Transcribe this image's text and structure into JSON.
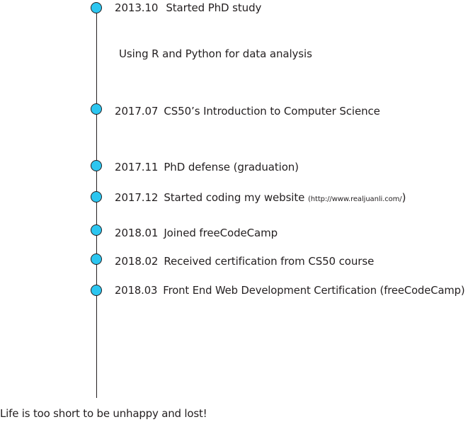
{
  "timeline": {
    "entries": [
      {
        "date": "2013.10",
        "text": "Started PhD study",
        "link": ""
      },
      {
        "date": "2017.07",
        "text": "CS50’s Introduction to Computer Science",
        "link": ""
      },
      {
        "date": "2017.11",
        "text": "PhD defense (graduation)",
        "link": ""
      },
      {
        "date": "2017.12",
        "text": "Started coding my website ",
        "link": "(http://www.realjuanli.com/",
        "link_close": ")"
      },
      {
        "date": "2018.01",
        "text": "Joined freeCodeCamp",
        "link": ""
      },
      {
        "date": "2018.02",
        "text": "Received certification from CS50 course",
        "link": ""
      },
      {
        "date": "2018.03",
        "text": "Front End Web Development Certification (freeCodeCamp)",
        "link": ""
      }
    ],
    "note": "Using R and Python for data analysis"
  },
  "motto": "Life is too short to be unhappy and lost!",
  "colors": {
    "node_fill": "#2cc6f0",
    "line": "#231f20",
    "text": "#231f20"
  }
}
